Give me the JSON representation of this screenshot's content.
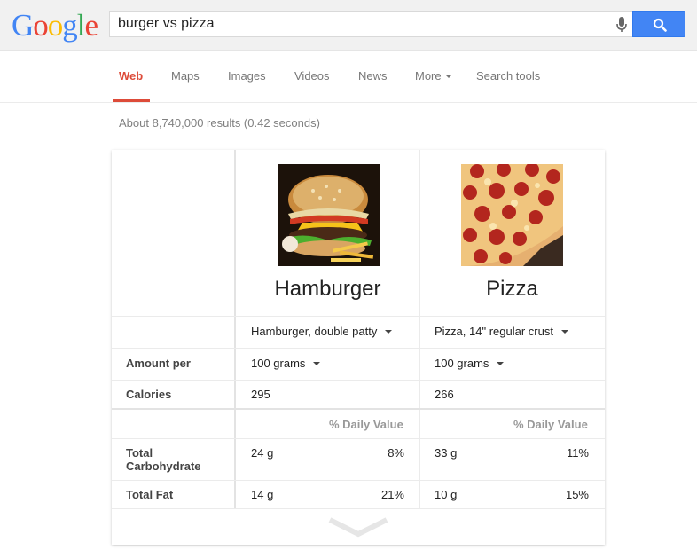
{
  "logo": {
    "letters": [
      "G",
      "o",
      "o",
      "g",
      "l",
      "e"
    ]
  },
  "search": {
    "query": "burger vs pizza"
  },
  "tabs": [
    {
      "label": "Web"
    },
    {
      "label": "Maps"
    },
    {
      "label": "Images"
    },
    {
      "label": "Videos"
    },
    {
      "label": "News"
    },
    {
      "label": "More"
    },
    {
      "label": "Search tools"
    }
  ],
  "result_stats": "About 8,740,000 results (0.42 seconds)",
  "comparison": {
    "foods": [
      {
        "name": "Hamburger",
        "variant": "Hamburger, double patty",
        "amount": "100 grams",
        "calories": "295",
        "carb": {
          "amount": "24 g",
          "dv": "8%"
        },
        "fat": {
          "amount": "14 g",
          "dv": "21%"
        }
      },
      {
        "name": "Pizza",
        "variant": "Pizza, 14\" regular crust",
        "amount": "100 grams",
        "calories": "266",
        "carb": {
          "amount": "33 g",
          "dv": "11%"
        },
        "fat": {
          "amount": "10 g",
          "dv": "15%"
        }
      }
    ],
    "labels": {
      "amount_per": "Amount per",
      "calories": "Calories",
      "daily_value": "% Daily Value",
      "total_carb": "Total Carbohydrate",
      "total_fat": "Total Fat"
    }
  },
  "colors": {
    "accent_red": "#dd4b39",
    "search_blue": "#4285f4"
  }
}
